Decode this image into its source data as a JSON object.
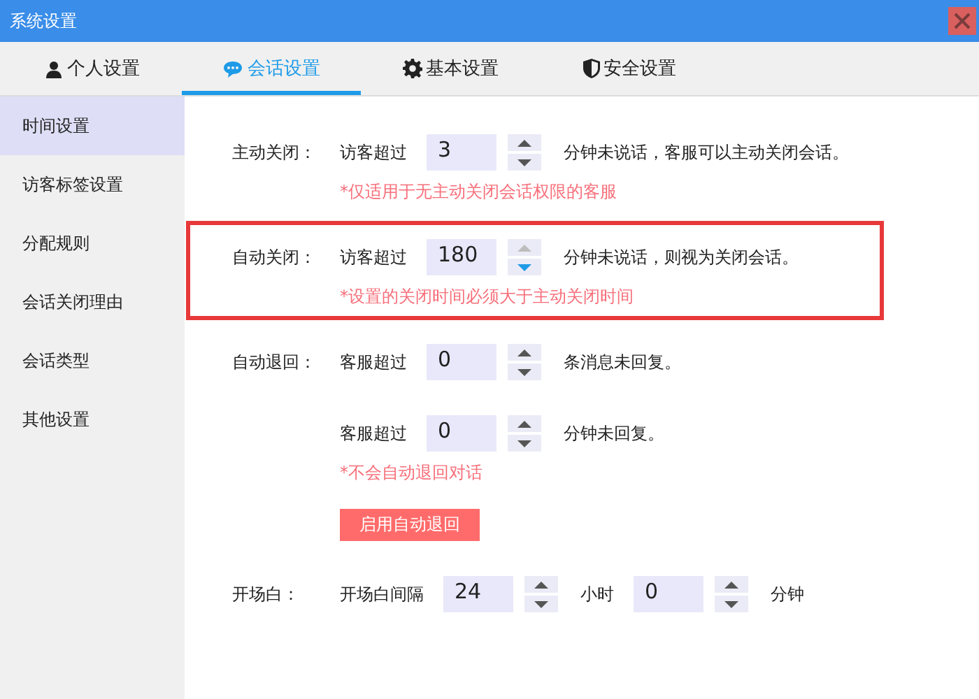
{
  "window": {
    "title": "系统设置"
  },
  "tabs": [
    {
      "label": "个人设置",
      "kind": "user",
      "selected": false
    },
    {
      "label": "会话设置",
      "kind": "chat",
      "selected": true
    },
    {
      "label": "基本设置",
      "kind": "gear",
      "selected": false
    },
    {
      "label": "安全设置",
      "kind": "shield",
      "selected": false
    }
  ],
  "sidebar": {
    "items": [
      {
        "label": "时间设置",
        "selected": true
      },
      {
        "label": "访客标签设置",
        "selected": false
      },
      {
        "label": "分配规则",
        "selected": false
      },
      {
        "label": "会话关闭理由",
        "selected": false
      },
      {
        "label": "会话类型",
        "selected": false
      },
      {
        "label": "其他设置",
        "selected": false
      }
    ]
  },
  "sections": [
    {
      "label": "主动关闭：",
      "highlighted": false,
      "rows": [
        [
          {
            "kind": "text",
            "text": "访客超过"
          },
          {
            "kind": "spinner",
            "value": "3",
            "up_disabled": false,
            "down_hover": false
          },
          {
            "kind": "text",
            "text": "分钟未说话，客服可以主动关闭会话。"
          }
        ]
      ],
      "note": "*仅适用于无主动关闭会话权限的客服"
    },
    {
      "label": "自动关闭：",
      "highlighted": true,
      "rows": [
        [
          {
            "kind": "text",
            "text": "访客超过"
          },
          {
            "kind": "spinner",
            "value": "180",
            "up_disabled": true,
            "down_hover": true
          },
          {
            "kind": "text",
            "text": "分钟未说话，则视为关闭会话。"
          }
        ]
      ],
      "note": "*设置的关闭时间必须大于主动关闭时间"
    },
    {
      "label": "自动退回：",
      "highlighted": false,
      "rows": [
        [
          {
            "kind": "text",
            "text": "客服超过"
          },
          {
            "kind": "spinner",
            "value": "0",
            "up_disabled": false,
            "down_hover": false
          },
          {
            "kind": "text",
            "text": "条消息未回复。"
          }
        ],
        [
          {
            "kind": "text",
            "text": "客服超过"
          },
          {
            "kind": "spinner",
            "value": "0",
            "up_disabled": false,
            "down_hover": false
          },
          {
            "kind": "text",
            "text": "分钟未回复。"
          }
        ]
      ],
      "note": "*不会自动退回对话",
      "button": "启用自动退回"
    },
    {
      "label": "开场白：",
      "highlighted": false,
      "rows": [
        [
          {
            "kind": "text",
            "text": "开场白间隔"
          },
          {
            "kind": "spinner",
            "value": "24",
            "up_disabled": false,
            "down_hover": false
          },
          {
            "kind": "text",
            "text": "小时"
          },
          {
            "kind": "spinner",
            "value": "0",
            "up_disabled": false,
            "down_hover": false
          },
          {
            "kind": "text",
            "text": "分钟"
          }
        ]
      ]
    }
  ]
}
